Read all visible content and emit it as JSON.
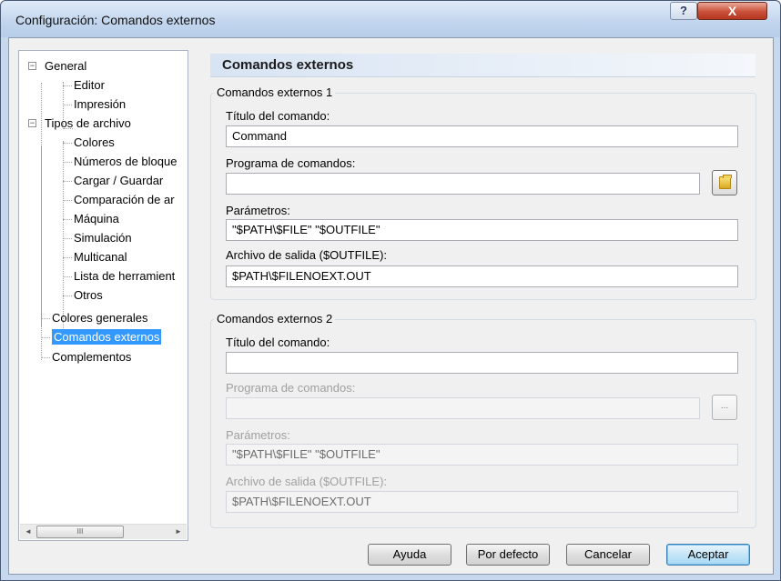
{
  "window": {
    "title": "Configuración: Comandos externos",
    "help_label": "?",
    "close_label": "X"
  },
  "tree": {
    "items": [
      {
        "label": "General",
        "expander": "−"
      },
      {
        "label": "Editor"
      },
      {
        "label": "Impresión"
      },
      {
        "label": "Tipos de archivo",
        "expander": "−"
      },
      {
        "label": "Colores"
      },
      {
        "label": "Números de bloque"
      },
      {
        "label": "Cargar / Guardar"
      },
      {
        "label": "Comparación de ar"
      },
      {
        "label": "Máquina"
      },
      {
        "label": "Simulación"
      },
      {
        "label": "Multicanal"
      },
      {
        "label": "Lista de herramient"
      },
      {
        "label": "Otros"
      },
      {
        "label": "Colores generales"
      },
      {
        "label": "Comandos externos",
        "selected": true
      },
      {
        "label": "Complementos"
      }
    ],
    "scroll_left": "◄",
    "scroll_right": "►",
    "scroll_thumb": "III"
  },
  "panel": {
    "title": "Comandos externos"
  },
  "group1": {
    "legend": "Comandos externos 1",
    "title_label": "Título del comando:",
    "title_value": "Command",
    "program_label": "Programa de comandos:",
    "program_value": "",
    "params_label": "Parámetros:",
    "params_value": "\"$PATH\\$FILE\" \"$OUTFILE\"",
    "output_label": "Archivo de salida ($OUTFILE):",
    "output_value": "$PATH\\$FILENOEXT.OUT"
  },
  "group2": {
    "legend": "Comandos externos 2",
    "title_label": "Título del comando:",
    "title_value": "",
    "program_label": "Programa de comandos:",
    "program_value": "",
    "browse_label": "...",
    "params_label": "Parámetros:",
    "params_value": "\"$PATH\\$FILE\" \"$OUTFILE\"",
    "output_label": "Archivo de salida ($OUTFILE):",
    "output_value": "$PATH\\$FILENOEXT.OUT"
  },
  "buttons": {
    "help": "Ayuda",
    "defaults": "Por defecto",
    "cancel": "Cancelar",
    "accept": "Aceptar"
  }
}
